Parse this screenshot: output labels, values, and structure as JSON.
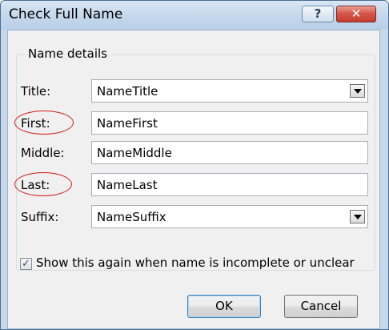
{
  "window": {
    "title": "Check Full Name",
    "help_glyph": "?",
    "close_glyph": "✕"
  },
  "group": {
    "label": "Name details"
  },
  "fields": {
    "title": {
      "label": "Title:",
      "value": "NameTitle"
    },
    "first": {
      "label": "First:",
      "value": "NameFirst"
    },
    "middle": {
      "label": "Middle:",
      "value": "NameMiddle"
    },
    "last": {
      "label": "Last:",
      "value": "NameLast"
    },
    "suffix": {
      "label": "Suffix:",
      "value": "NameSuffix"
    }
  },
  "checkbox": {
    "label": "Show this again when name is incomplete or unclear",
    "checked_glyph": "✓",
    "checked": true
  },
  "buttons": {
    "ok": "OK",
    "cancel": "Cancel"
  },
  "colors": {
    "highlight_ellipse": "#d41c1c",
    "close_button": "#c33d31"
  }
}
